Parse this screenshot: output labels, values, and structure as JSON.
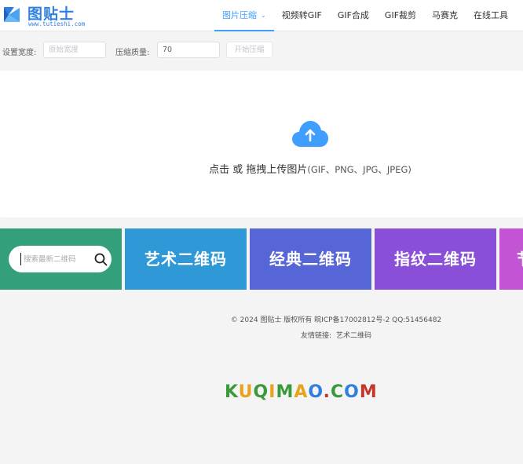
{
  "header": {
    "logo_text": "图贴士",
    "logo_url": "www.tutieshi.com",
    "nav": [
      {
        "label": "图片压缩",
        "active": true
      },
      {
        "label": "视频转GIF"
      },
      {
        "label": "GIF合成"
      },
      {
        "label": "GIF裁剪"
      },
      {
        "label": "马赛克"
      },
      {
        "label": "在线工具"
      }
    ]
  },
  "settings": {
    "width_label": "设置宽度:",
    "width_placeholder": "原始宽度",
    "quality_label": "压缩质量:",
    "quality_value": "70",
    "start_button": "开始压缩"
  },
  "upload": {
    "text": "点击 或 拖拽上传图片",
    "formats": "(GIF、PNG、JPG、JPEG)"
  },
  "banner": {
    "search_placeholder": "搜索最新二维码",
    "tiles": [
      "艺术二维码",
      "经典二维码",
      "指纹二维码",
      "节"
    ]
  },
  "footer": {
    "copyright": "© 2024 图贴士 版权所有 皖ICP备17002812号-2 QQ:51456482",
    "friends_label": "友情链接:",
    "friends_link": "艺术二维码"
  },
  "sponsor": {
    "letters": [
      "K",
      "U",
      "Q",
      "I",
      "M",
      "A",
      "O",
      ".",
      "C",
      "O",
      "M"
    ]
  },
  "colors": {
    "accent": "#409eff",
    "search_tile": "#34a07b",
    "tile_1": "#2f98d6",
    "tile_2": "#5766d6",
    "tile_3": "#8a4fd8",
    "tile_4": "#c354d3"
  }
}
